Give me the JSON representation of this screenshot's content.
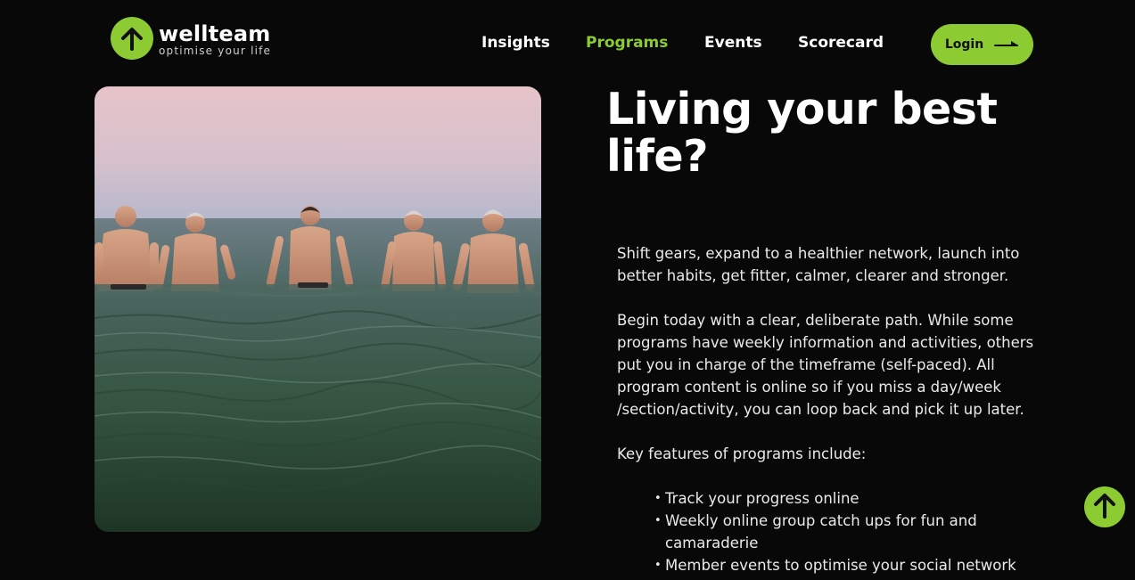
{
  "brand": {
    "name": "wellteam",
    "tagline": "optimise your life",
    "logo_icon": "arrow-up-icon",
    "accent_color": "#8ccc32",
    "background_color": "#080808"
  },
  "nav": {
    "items": [
      {
        "label": "Insights",
        "active": false
      },
      {
        "label": "Programs",
        "active": true
      },
      {
        "label": "Events",
        "active": false
      },
      {
        "label": "Scorecard",
        "active": false
      }
    ],
    "login_label": "Login",
    "login_icon": "arrow-right-icon"
  },
  "hero": {
    "image_alt": "Five men standing waist-deep in the sea at dusk",
    "headline": "Living your best life?",
    "paragraphs": [
      "Shift gears, expand to a healthier network, launch into better habits, get fitter, calmer, clearer and stronger.",
      "Begin today with a clear, deliberate path. While some programs have weekly information and activities, others put you in charge of the timeframe (self-paced). All program content is online so if you miss a day/week /section/activity, you can loop back and pick it up later.",
      "Key features of programs include:"
    ],
    "features": [
      "Track your progress online",
      "Weekly online group catch ups for fun and camaraderie",
      "Member events to optimise your social network"
    ]
  },
  "scroll_top_icon": "arrow-up-icon"
}
